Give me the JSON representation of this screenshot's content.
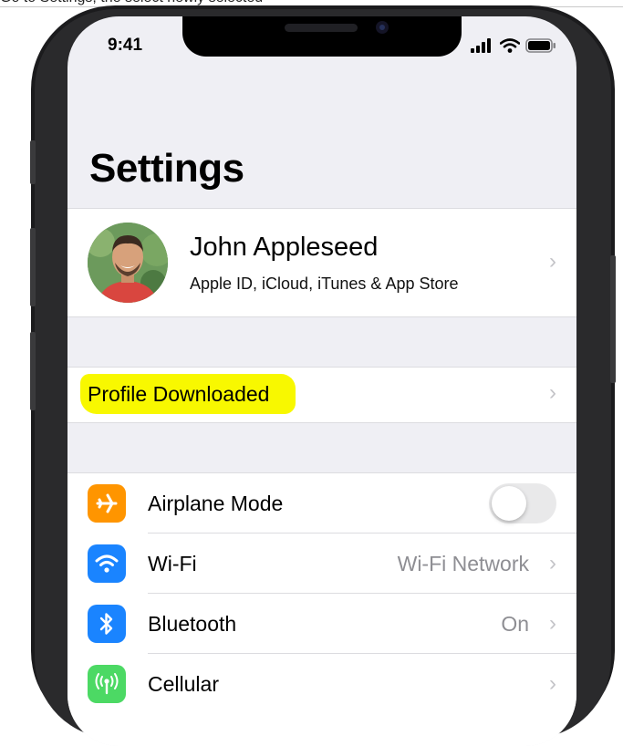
{
  "caption": "Go to Settings, the select newly selected",
  "status_bar": {
    "time": "9:41"
  },
  "header": {
    "title": "Settings"
  },
  "account": {
    "name": "John Appleseed",
    "subtitle": "Apple ID, iCloud, iTunes & App Store"
  },
  "profile": {
    "label": "Profile Downloaded",
    "highlight_color": "#f8f800"
  },
  "settings": {
    "airplane": {
      "label": "Airplane Mode",
      "icon": "airplane-icon",
      "color": "#ff9500",
      "toggle_on": false
    },
    "wifi": {
      "label": "Wi-Fi",
      "value": "Wi-Fi Network",
      "icon": "wifi-icon",
      "color": "#1a84ff"
    },
    "bluetooth": {
      "label": "Bluetooth",
      "value": "On",
      "icon": "bluetooth-icon",
      "color": "#1a84ff"
    },
    "cellular": {
      "label": "Cellular",
      "icon": "cellular-antenna-icon",
      "color": "#4cd964"
    }
  }
}
